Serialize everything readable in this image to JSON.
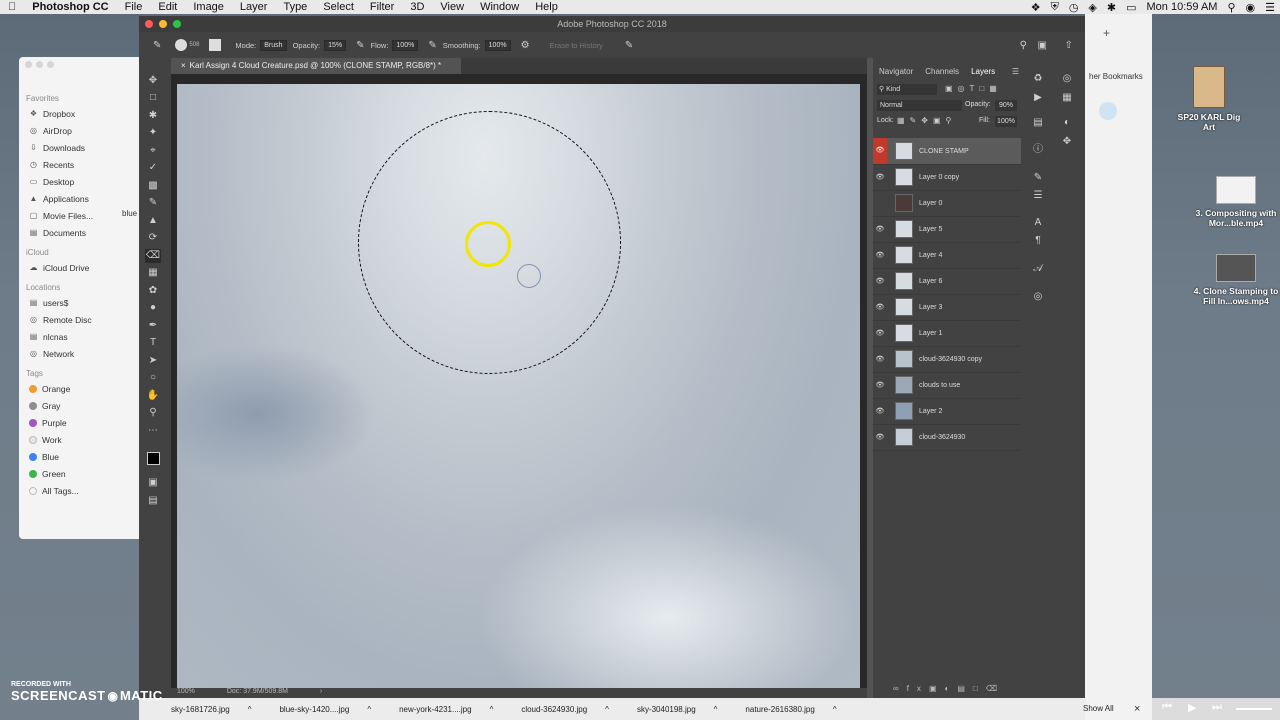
{
  "menubar": {
    "app": "Photoshop CC",
    "items": [
      "File",
      "Edit",
      "Image",
      "Layer",
      "Type",
      "Select",
      "Filter",
      "3D",
      "View",
      "Window",
      "Help"
    ],
    "clock": "Mon 10:59 AM"
  },
  "finder": {
    "favorites_title": "Favorites",
    "favorites": [
      "Dropbox",
      "AirDrop",
      "Downloads",
      "Recents",
      "Desktop",
      "Applications",
      "Movie Files...",
      "Documents"
    ],
    "icloud_title": "iCloud",
    "icloud": [
      "iCloud Drive"
    ],
    "locations_title": "Locations",
    "locations": [
      "users$",
      "Remote Disc",
      "nlcnas",
      "Network"
    ],
    "tags_title": "Tags",
    "tags": [
      {
        "label": "Orange",
        "color": "#f39c34"
      },
      {
        "label": "Gray",
        "color": "#8e8e8e"
      },
      {
        "label": "Purple",
        "color": "#a155c4"
      },
      {
        "label": "Work",
        "color": "#e6e6e6"
      },
      {
        "label": "Blue",
        "color": "#3b82f6"
      },
      {
        "label": "Green",
        "color": "#3cb44b"
      },
      {
        "label": "All Tags...",
        "color": ""
      }
    ],
    "peek_text": "blue"
  },
  "photoshop": {
    "window_title": "Adobe Photoshop CC 2018",
    "options": {
      "brush_size": "508",
      "mode_label": "Mode:",
      "mode_value": "Brush",
      "opacity_label": "Opacity:",
      "opacity_value": "15%",
      "flow_label": "Flow:",
      "flow_value": "100%",
      "smoothing_label": "Smoothing:",
      "smoothing_value": "100%",
      "erase_history": "Erase to History"
    },
    "doc_tab": "Karl Assign 4 Cloud Creature.psd @ 100% (CLONE STAMP, RGB/8*) *",
    "status": {
      "zoom": "100%",
      "doc": "Doc: 37.9M/509.8M"
    },
    "panel_tabs": [
      "Navigator",
      "Channels",
      "Layers"
    ],
    "layers_panel": {
      "filter_kind": "Kind",
      "blend_mode": "Normal",
      "opacity_label": "Opacity:",
      "opacity_value": "90%",
      "lock_label": "Lock:",
      "fill_label": "Fill:",
      "fill_value": "100%",
      "layers": [
        {
          "name": "CLONE STAMP",
          "visible": true,
          "selected": true
        },
        {
          "name": "Layer 0 copy",
          "visible": true,
          "selected": false
        },
        {
          "name": "Layer 0",
          "visible": false,
          "selected": false
        },
        {
          "name": "Layer 5",
          "visible": true,
          "selected": false
        },
        {
          "name": "Layer 4",
          "visible": true,
          "selected": false
        },
        {
          "name": "Layer 6",
          "visible": true,
          "selected": false
        },
        {
          "name": "Layer 3",
          "visible": true,
          "selected": false
        },
        {
          "name": "Layer 1",
          "visible": true,
          "selected": false
        },
        {
          "name": "cloud-3624930 copy",
          "visible": true,
          "selected": false
        },
        {
          "name": "clouds to use",
          "visible": true,
          "selected": false
        },
        {
          "name": "Layer 2",
          "visible": true,
          "selected": false
        },
        {
          "name": "cloud-3624930",
          "visible": true,
          "selected": false
        }
      ]
    }
  },
  "browser": {
    "bookmarks_text": "her Bookmarks"
  },
  "desktop_icons": [
    {
      "label": "SP20 KARL Dig Art"
    },
    {
      "label": "3. Compositing with Mor...ble.mp4"
    },
    {
      "label": "4. Clone Stamping to Fill In...ows.mp4"
    }
  ],
  "downloads": {
    "files": [
      "sky-1681726.jpg",
      "blue-sky-1420....jpg",
      "new-york-4231....jpg",
      "cloud-3624930.jpg",
      "sky-3040198.jpg",
      "nature-2616380.jpg"
    ],
    "show_all": "Show All"
  },
  "watermark": {
    "line1": "RECORDED WITH",
    "line2": "SCREENCAST",
    "line3": "MATIC"
  },
  "colors": {
    "selected_layer_eye": "#c0392b",
    "brush_cursor": "#f2e600"
  }
}
